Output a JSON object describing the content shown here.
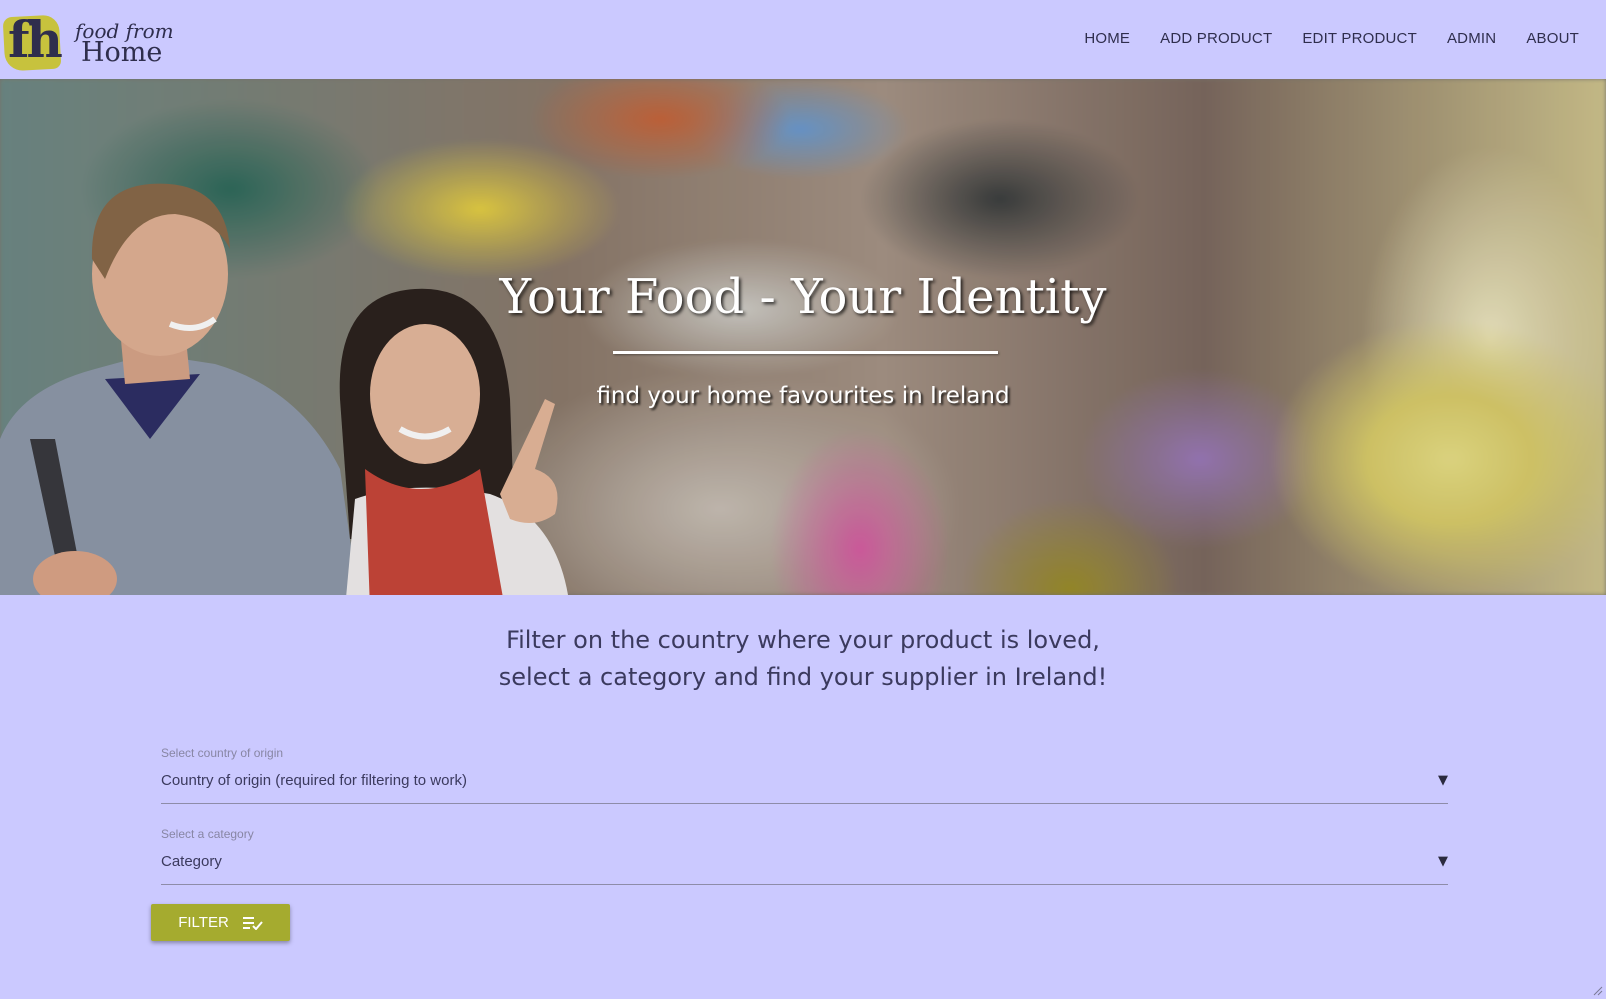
{
  "brand": {
    "mark": "fh",
    "line1": "food from",
    "line2": "Home"
  },
  "nav": {
    "items": [
      {
        "label": "HOME"
      },
      {
        "label": "ADD PRODUCT"
      },
      {
        "label": "EDIT PRODUCT"
      },
      {
        "label": "ADMIN"
      },
      {
        "label": "ABOUT"
      }
    ]
  },
  "hero": {
    "title": "Your Food - Your Identity",
    "subtitle": "find your home favourites in Ireland"
  },
  "intro": {
    "line1": "Filter on the country where your product is loved,",
    "line2": "select a category and find your supplier in Ireland!"
  },
  "form": {
    "country": {
      "label": "Select country of origin",
      "value": "Country of origin (required for filtering to work)"
    },
    "category": {
      "label": "Select a category",
      "value": "Category"
    },
    "filter_button": {
      "label": "FILTER",
      "icon": "filter-list-icon"
    }
  },
  "colors": {
    "page_background": "#cbc9ff",
    "accent": "#a5ab2f",
    "logo_badge": "#c7c23d",
    "text": "#3b3a5e"
  }
}
